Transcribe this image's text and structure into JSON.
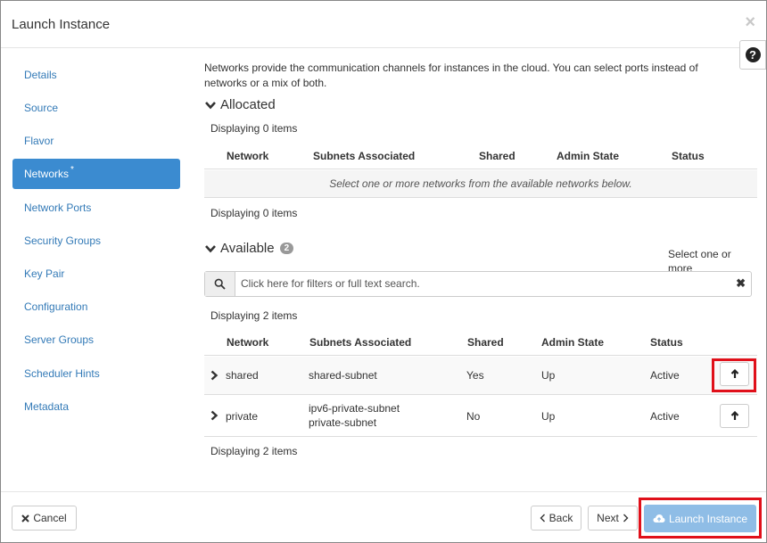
{
  "window": {
    "title": "Launch Instance",
    "close_glyph": "×",
    "help_glyph": "?"
  },
  "sidebar": {
    "items": [
      {
        "label": "Details",
        "active": false
      },
      {
        "label": "Source",
        "active": false
      },
      {
        "label": "Flavor",
        "active": false
      },
      {
        "label": "Networks",
        "active": true,
        "required_marker": "*"
      },
      {
        "label": "Network Ports",
        "active": false
      },
      {
        "label": "Security Groups",
        "active": false
      },
      {
        "label": "Key Pair",
        "active": false
      },
      {
        "label": "Configuration",
        "active": false
      },
      {
        "label": "Server Groups",
        "active": false
      },
      {
        "label": "Scheduler Hints",
        "active": false
      },
      {
        "label": "Metadata",
        "active": false
      }
    ]
  },
  "main": {
    "intro": "Networks provide the communication channels for instances in the cloud. You can select ports instead of networks or a mix of both.",
    "allocated": {
      "title": "Allocated",
      "displaying_top": "Displaying 0 items",
      "displaying_bottom": "Displaying 0 items",
      "columns": [
        "Network",
        "Subnets Associated",
        "Shared",
        "Admin State",
        "Status"
      ],
      "empty_message": "Select one or more networks from the available networks below."
    },
    "available": {
      "title": "Available",
      "count": "2",
      "hint": "Select one or more",
      "search_placeholder": "Click here for filters or full text search.",
      "search_clear": "✖",
      "displaying_top": "Displaying 2 items",
      "displaying_bottom": "Displaying 2 items",
      "columns": [
        "Network",
        "Subnets Associated",
        "Shared",
        "Admin State",
        "Status"
      ],
      "rows": [
        {
          "network": "shared",
          "subnets": [
            "shared-subnet"
          ],
          "shared": "Yes",
          "admin_state": "Up",
          "status": "Active"
        },
        {
          "network": "private",
          "subnets": [
            "ipv6-private-subnet",
            "private-subnet"
          ],
          "shared": "No",
          "admin_state": "Up",
          "status": "Active"
        }
      ]
    }
  },
  "footer": {
    "cancel_label": "Cancel",
    "back_label": "Back",
    "next_label": "Next",
    "launch_label": "Launch Instance"
  },
  "colors": {
    "accent": "#3b8bd0",
    "link": "#337ab7",
    "primary_button": "#8fbde6",
    "highlight": "#e0101a"
  }
}
